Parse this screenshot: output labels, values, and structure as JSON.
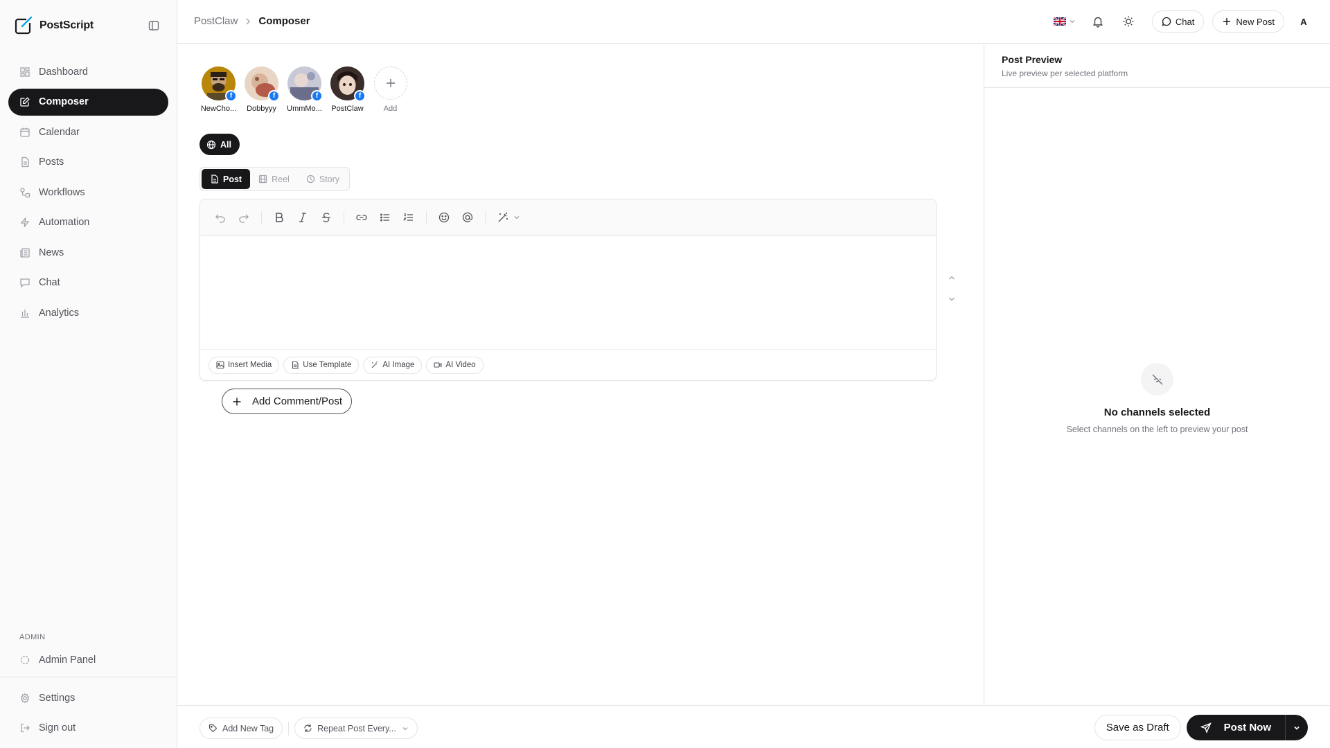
{
  "app": {
    "name": "PostScript"
  },
  "sidebar": {
    "items": [
      {
        "label": "Dashboard",
        "icon": "dashboard-icon"
      },
      {
        "label": "Composer",
        "icon": "edit-icon",
        "active": true
      },
      {
        "label": "Calendar",
        "icon": "calendar-icon"
      },
      {
        "label": "Posts",
        "icon": "document-icon"
      },
      {
        "label": "Workflows",
        "icon": "workflow-icon"
      },
      {
        "label": "Automation",
        "icon": "zap-icon"
      },
      {
        "label": "News",
        "icon": "newspaper-icon"
      },
      {
        "label": "Chat",
        "icon": "message-icon"
      },
      {
        "label": "Analytics",
        "icon": "bar-chart-icon"
      }
    ],
    "admin_section_label": "ADMIN",
    "admin_item": {
      "label": "Admin Panel",
      "icon": "shield-icon"
    },
    "bottom_items": [
      {
        "label": "Settings",
        "icon": "gear-icon"
      },
      {
        "label": "Sign out",
        "icon": "sign-out-icon"
      }
    ]
  },
  "header": {
    "breadcrumb": {
      "parent": "PostClaw",
      "current": "Composer"
    },
    "language_flag": "uk-flag-icon",
    "chat_label": "Chat",
    "new_post_label": "New Post",
    "avatar_initial": "A"
  },
  "composer": {
    "channels": [
      {
        "name": "NewCho...",
        "platform": "facebook"
      },
      {
        "name": "Dobbyyy",
        "platform": "facebook"
      },
      {
        "name": "UmmMo...",
        "platform": "facebook"
      },
      {
        "name": "PostClaw",
        "platform": "facebook"
      }
    ],
    "add_channel_label": "Add",
    "filter_chip": "All",
    "post_types": [
      {
        "label": "Post",
        "active": true
      },
      {
        "label": "Reel",
        "active": false
      },
      {
        "label": "Story",
        "active": false
      }
    ],
    "editor_actions": {
      "insert_media": "Insert Media",
      "use_template": "Use Template",
      "ai_image": "AI Image",
      "ai_video": "AI Video"
    },
    "add_comment_label": "Add Comment/Post"
  },
  "preview": {
    "title": "Post Preview",
    "subtitle": "Live preview per selected platform",
    "empty_title": "No channels selected",
    "empty_subtitle": "Select channels on the left to preview your post"
  },
  "footer": {
    "add_tag_label": "Add New Tag",
    "repeat_label": "Repeat Post Every...",
    "save_draft_label": "Save as Draft",
    "post_now_label": "Post Now"
  },
  "colors": {
    "primary": "#18181b",
    "border": "#e4e4e7",
    "muted_text": "#71717a",
    "sidebar_bg": "#fafafa",
    "facebook_blue": "#1877f2"
  }
}
